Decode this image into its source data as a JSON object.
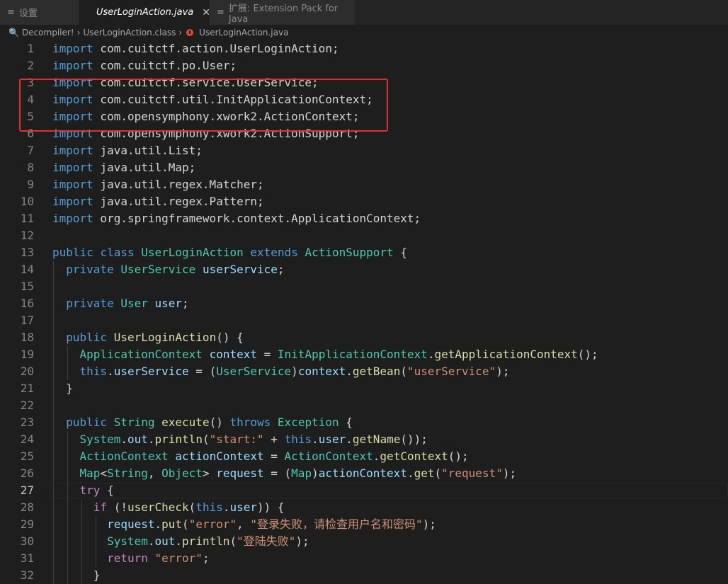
{
  "tabs": [
    {
      "icon": "settings-icon",
      "label": "设置"
    },
    {
      "icon": "java-icon",
      "label": "UserLoginAction.java",
      "active": true
    },
    {
      "icon": "extension-icon",
      "label": "扩展: Extension Pack for Java"
    }
  ],
  "breadcrumb": [
    "Decompiler!",
    "UserLoginAction.class",
    "UserLoginAction.java"
  ],
  "editor": {
    "current_line": 27,
    "lines": [
      [
        [
          "kw",
          "import"
        ],
        [
          "op",
          " com.cuitctf.action.UserLoginAction;"
        ]
      ],
      [
        [
          "kw",
          "import"
        ],
        [
          "op",
          " com.cuitctf.po.User;"
        ]
      ],
      [
        [
          "kw",
          "import"
        ],
        [
          "op",
          " com.cuitctf.service.UserService;"
        ]
      ],
      [
        [
          "kw",
          "import"
        ],
        [
          "op",
          " com.cuitctf.util.InitApplicationContext;"
        ]
      ],
      [
        [
          "kw",
          "import"
        ],
        [
          "op",
          " com.opensymphony.xwork2.ActionContext;"
        ]
      ],
      [
        [
          "kw",
          "import"
        ],
        [
          "op",
          " com.opensymphony.xwork2.ActionSupport;"
        ]
      ],
      [
        [
          "kw",
          "import"
        ],
        [
          "op",
          " java.util.List;"
        ]
      ],
      [
        [
          "kw",
          "import"
        ],
        [
          "op",
          " java.util.Map;"
        ]
      ],
      [
        [
          "kw",
          "import"
        ],
        [
          "op",
          " java.util.regex.Matcher;"
        ]
      ],
      [
        [
          "kw",
          "import"
        ],
        [
          "op",
          " java.util.regex.Pattern;"
        ]
      ],
      [
        [
          "kw",
          "import"
        ],
        [
          "op",
          " org.springframework.context.ApplicationContext;"
        ]
      ],
      [],
      [
        [
          "kw",
          "public"
        ],
        [
          "op",
          " "
        ],
        [
          "kw",
          "class"
        ],
        [
          "op",
          " "
        ],
        [
          "ty",
          "UserLoginAction"
        ],
        [
          "op",
          " "
        ],
        [
          "kw",
          "extends"
        ],
        [
          "op",
          " "
        ],
        [
          "ty",
          "ActionSupport"
        ],
        [
          "op",
          " {"
        ]
      ],
      [
        [
          "op",
          "  "
        ],
        [
          "kw",
          "private"
        ],
        [
          "op",
          " "
        ],
        [
          "ty",
          "UserService"
        ],
        [
          "op",
          " "
        ],
        [
          "vr",
          "userService"
        ],
        [
          "op",
          ";"
        ]
      ],
      [],
      [
        [
          "op",
          "  "
        ],
        [
          "kw",
          "private"
        ],
        [
          "op",
          " "
        ],
        [
          "ty",
          "User"
        ],
        [
          "op",
          " "
        ],
        [
          "vr",
          "user"
        ],
        [
          "op",
          ";"
        ]
      ],
      [],
      [
        [
          "op",
          "  "
        ],
        [
          "kw",
          "public"
        ],
        [
          "op",
          " "
        ],
        [
          "fn",
          "UserLoginAction"
        ],
        [
          "op",
          "() {"
        ]
      ],
      [
        [
          "op",
          "    "
        ],
        [
          "ty",
          "ApplicationContext"
        ],
        [
          "op",
          " "
        ],
        [
          "vr",
          "context"
        ],
        [
          "op",
          " = "
        ],
        [
          "ty",
          "InitApplicationContext"
        ],
        [
          "op",
          "."
        ],
        [
          "fn",
          "getApplicationContext"
        ],
        [
          "op",
          "();"
        ]
      ],
      [
        [
          "op",
          "    "
        ],
        [
          "kw",
          "this"
        ],
        [
          "op",
          "."
        ],
        [
          "vr",
          "userService"
        ],
        [
          "op",
          " = ("
        ],
        [
          "ty",
          "UserService"
        ],
        [
          "op",
          ")"
        ],
        [
          "vr",
          "context"
        ],
        [
          "op",
          "."
        ],
        [
          "fn",
          "getBean"
        ],
        [
          "op",
          "("
        ],
        [
          "st",
          "\"userService\""
        ],
        [
          "op",
          ");"
        ]
      ],
      [
        [
          "op",
          "  }"
        ]
      ],
      [],
      [
        [
          "op",
          "  "
        ],
        [
          "kw",
          "public"
        ],
        [
          "op",
          " "
        ],
        [
          "ty",
          "String"
        ],
        [
          "op",
          " "
        ],
        [
          "fn",
          "execute"
        ],
        [
          "op",
          "() "
        ],
        [
          "kw",
          "throws"
        ],
        [
          "op",
          " "
        ],
        [
          "ty",
          "Exception"
        ],
        [
          "op",
          " {"
        ]
      ],
      [
        [
          "op",
          "    "
        ],
        [
          "ty",
          "System"
        ],
        [
          "op",
          "."
        ],
        [
          "vr",
          "out"
        ],
        [
          "op",
          "."
        ],
        [
          "fn",
          "println"
        ],
        [
          "op",
          "("
        ],
        [
          "st",
          "\"start:\""
        ],
        [
          "op",
          " + "
        ],
        [
          "kw",
          "this"
        ],
        [
          "op",
          "."
        ],
        [
          "vr",
          "user"
        ],
        [
          "op",
          "."
        ],
        [
          "fn",
          "getName"
        ],
        [
          "op",
          "());"
        ]
      ],
      [
        [
          "op",
          "    "
        ],
        [
          "ty",
          "ActionContext"
        ],
        [
          "op",
          " "
        ],
        [
          "vr",
          "actionContext"
        ],
        [
          "op",
          " = "
        ],
        [
          "ty",
          "ActionContext"
        ],
        [
          "op",
          "."
        ],
        [
          "fn",
          "getContext"
        ],
        [
          "op",
          "();"
        ]
      ],
      [
        [
          "op",
          "    "
        ],
        [
          "ty",
          "Map"
        ],
        [
          "op",
          "<"
        ],
        [
          "ty",
          "String"
        ],
        [
          "op",
          ", "
        ],
        [
          "ty",
          "Object"
        ],
        [
          "op",
          "> "
        ],
        [
          "vr",
          "request"
        ],
        [
          "op",
          " = ("
        ],
        [
          "ty",
          "Map"
        ],
        [
          "op",
          ")"
        ],
        [
          "vr",
          "actionContext"
        ],
        [
          "op",
          "."
        ],
        [
          "fn",
          "get"
        ],
        [
          "op",
          "("
        ],
        [
          "st",
          "\"request\""
        ],
        [
          "op",
          ");"
        ]
      ],
      [
        [
          "op",
          "    "
        ],
        [
          "kc",
          "try"
        ],
        [
          "op",
          " {"
        ]
      ],
      [
        [
          "op",
          "      "
        ],
        [
          "kc",
          "if"
        ],
        [
          "op",
          " (!"
        ],
        [
          "fn",
          "userCheck"
        ],
        [
          "op",
          "("
        ],
        [
          "kw",
          "this"
        ],
        [
          "op",
          "."
        ],
        [
          "vr",
          "user"
        ],
        [
          "op",
          ")) {"
        ]
      ],
      [
        [
          "op",
          "        "
        ],
        [
          "vr",
          "request"
        ],
        [
          "op",
          "."
        ],
        [
          "fn",
          "put"
        ],
        [
          "op",
          "("
        ],
        [
          "st",
          "\"error\""
        ],
        [
          "op",
          ", "
        ],
        [
          "st",
          "\"登录失败，请检查用户名和密码\""
        ],
        [
          "op",
          ");"
        ]
      ],
      [
        [
          "op",
          "        "
        ],
        [
          "ty",
          "System"
        ],
        [
          "op",
          "."
        ],
        [
          "vr",
          "out"
        ],
        [
          "op",
          "."
        ],
        [
          "fn",
          "println"
        ],
        [
          "op",
          "("
        ],
        [
          "st",
          "\"登陆失败\""
        ],
        [
          "op",
          ");"
        ]
      ],
      [
        [
          "op",
          "        "
        ],
        [
          "kc",
          "return"
        ],
        [
          "op",
          " "
        ],
        [
          "st",
          "\"error\""
        ],
        [
          "op",
          ";"
        ]
      ],
      [
        [
          "op",
          "      }"
        ]
      ]
    ]
  }
}
